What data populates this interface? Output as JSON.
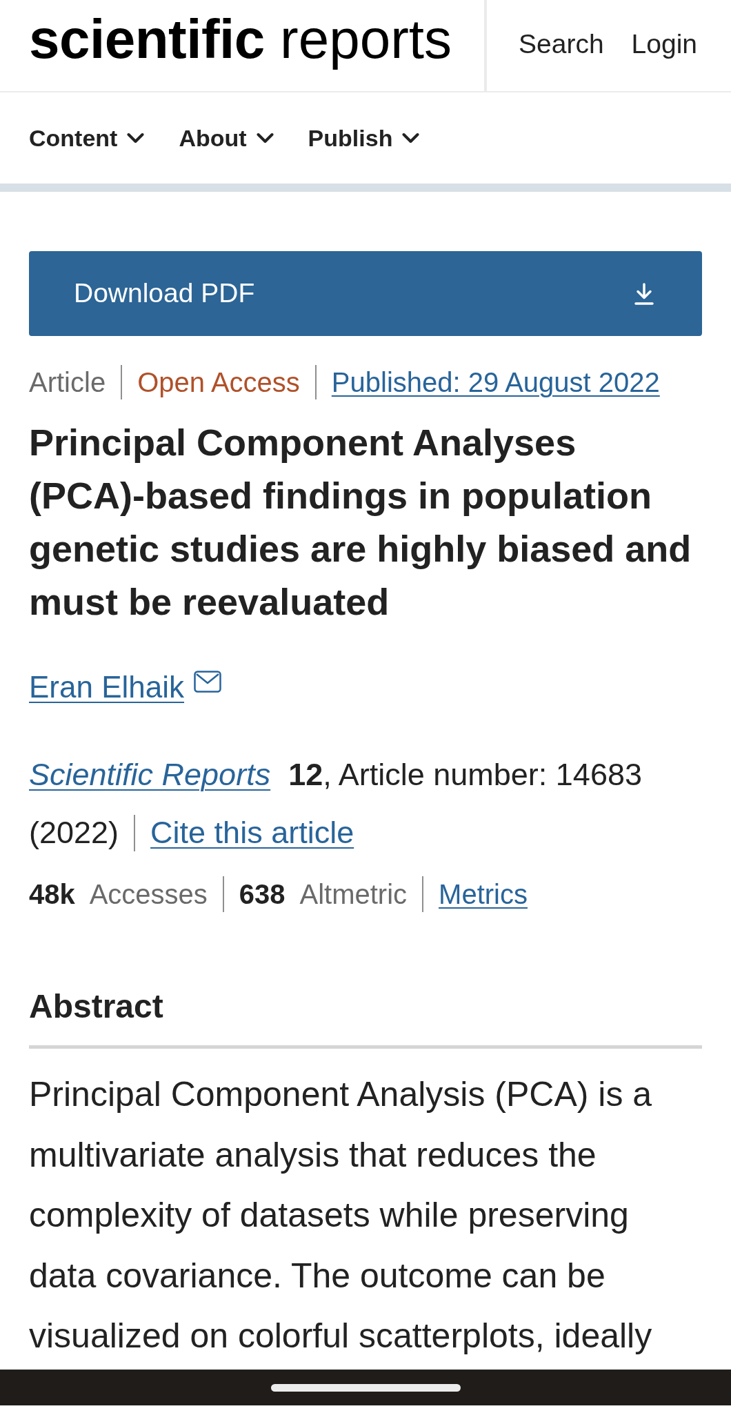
{
  "header": {
    "logo": "**scientific** reports",
    "links": [
      "Search",
      "Login"
    ]
  },
  "nav": [
    {
      "label": "Content"
    },
    {
      "label": "About"
    },
    {
      "label": "Publish"
    }
  ],
  "download_button": {
    "label": "Download PDF"
  },
  "article_info": [
    {
      "kind": "type",
      "text": "Article"
    },
    {
      "kind": "access",
      "text": "Open Access"
    },
    {
      "kind": "date",
      "text": "Published: 29 August 2022"
    }
  ],
  "title": "Principal Component Analyses (PCA)-based findings in population genetic studies are highly biased and must be reevaluated",
  "authors": [
    {
      "name": "Eran Elhaik",
      "email": true
    }
  ],
  "citation": {
    "journal": "Scientific Reports",
    "volume": "**12**, Article number: 14683",
    "year": "(2022)",
    "cite_link": "Cite this article"
  },
  "metrics": {
    "stats": [
      "**48k** Accesses",
      "**638** Altmetric"
    ],
    "link": "Metrics"
  },
  "abstract": {
    "heading": "Abstract",
    "text": "Principal Component Analysis (PCA) is a multivariate analysis that reduces the complexity of datasets while preserving data covariance. The outcome can be visualized on colorful scatterplots, ideally"
  }
}
